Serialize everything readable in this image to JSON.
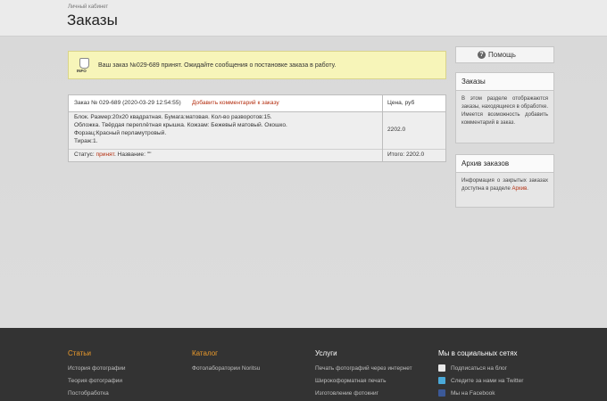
{
  "header": {
    "breadcrumb": "Личный кабинет",
    "title": "Заказы"
  },
  "notice": {
    "icon_label": "INFO",
    "text": "Ваш заказ №029-689 принят. Ожидайте сообщения о постановке заказа в работу."
  },
  "order": {
    "title": "Заказ № 029-689 (2020-03-29 12:54:55)",
    "add_comment": "Добавить комментарий к заказу",
    "price_header": "Цена, руб",
    "details": [
      "Блок. Размер:20х20 квадратная. Бумага:матовая. Кол-во разворотов:15.",
      "Обложка. Твёрдая переплётная крышка. Кожзам: Бежевый матовый. Окошко.",
      "Форзац:Красный перламутровый.",
      "Тираж:1."
    ],
    "price": "2202.0",
    "status_label": "Статус:",
    "status_value": "принят",
    "name_label": ". Название: \"\"",
    "total": "Итого: 2202.0"
  },
  "sidebar": {
    "help_label": "Помощь",
    "orders_box": {
      "title": "Заказы",
      "text": "В этом разделе отображаются заказы, находящиеся в обработке. Имеется возможность добавить комментарий в заказ."
    },
    "archive_box": {
      "title": "Архив заказов",
      "text_before": "Информация о закрытых заказах доступна в разделе ",
      "link": "Архив",
      "text_after": "."
    }
  },
  "footer": {
    "col1": {
      "title": "Статьи",
      "items": [
        "История фотографии",
        "Теория фотографии",
        "Постобработка"
      ]
    },
    "col2": {
      "title": "Каталог",
      "items": [
        "Фотолаборатории Noritsu"
      ]
    },
    "col3": {
      "title": "Услуги",
      "items": [
        "Печать фотографий через интернет",
        "Широкоформатная печать",
        "Изготовление фотокниг"
      ]
    },
    "col4": {
      "title": "Мы в социальных сетях",
      "items": [
        "Подписаться на блог",
        "Следите за нами на Twitter",
        "Мы на Facebook"
      ]
    }
  },
  "colors": {
    "link": "#b32d0e",
    "footer_heading": "#ec9b2c",
    "notice_bg": "#f7f5b9",
    "footer_bg": "#333333"
  }
}
